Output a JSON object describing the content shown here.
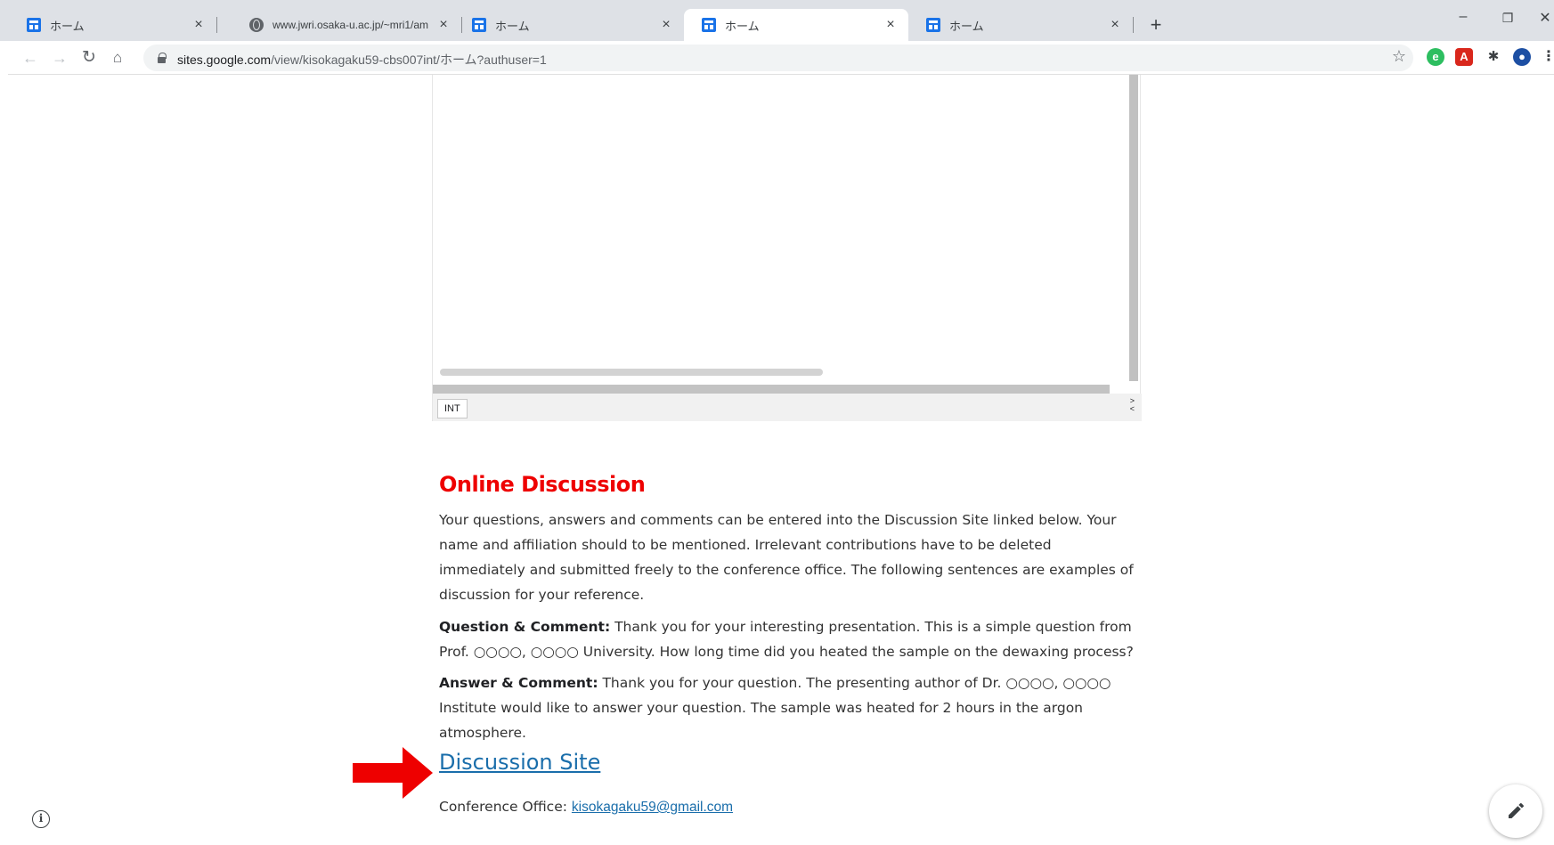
{
  "browser": {
    "tabs": [
      {
        "title": "ホーム",
        "favicon": "google-sites-icon",
        "active": false
      },
      {
        "title": "www.jwri.osaka-u.ac.jp/~mri1/am",
        "favicon": "globe-icon",
        "active": false
      },
      {
        "title": "ホーム",
        "favicon": "google-sites-icon",
        "active": false
      },
      {
        "title": "ホーム",
        "favicon": "google-sites-icon",
        "active": true
      },
      {
        "title": "ホーム",
        "favicon": "google-sites-icon",
        "active": false
      }
    ],
    "new_tab_label": "+",
    "window_controls": {
      "minimize": "–",
      "restore": "❐",
      "close": "✕"
    },
    "url_host": "sites.google.com",
    "url_path": "/view/kisokagaku59-cbs007int/ホーム?authuser=1",
    "extensions": [
      "evernote-icon",
      "acrobat-icon",
      "puzzle-extensions-icon",
      "profile-avatar-icon"
    ]
  },
  "viewer": {
    "status_button": "INT",
    "arrow_up": ">",
    "arrow_down": "<"
  },
  "section": {
    "heading": "Online Discussion",
    "heading_color": "#ee0000",
    "intro": "Your questions, answers and comments can be entered into the Discussion Site linked below.  Your name and affiliation should to be mentioned.  Irrelevant contributions have to be deleted immediately and submitted freely to the conference office.  The following sentences are examples of discussion for your reference.",
    "question_label": "Question & Comment:",
    "question_text": " Thank you for your interesting presentation. This is a simple question from Prof. ○○○○, ○○○○ University. How long time did you heated the sample on the dewaxing process?",
    "answer_label": "Answer & Comment:",
    "answer_text": " Thank you for your question. The presenting author of Dr. ○○○○, ○○○○ Institute would like to answer your question. The sample was heated for 2 hours in the argon atmosphere.",
    "discussion_link": "Discussion Site",
    "office_label": "Conference Office: ",
    "office_email": "kisokagaku59@gmail.com",
    "link_color": "#1a6eab"
  },
  "annotation": {
    "arrow_color": "#ee0000"
  }
}
